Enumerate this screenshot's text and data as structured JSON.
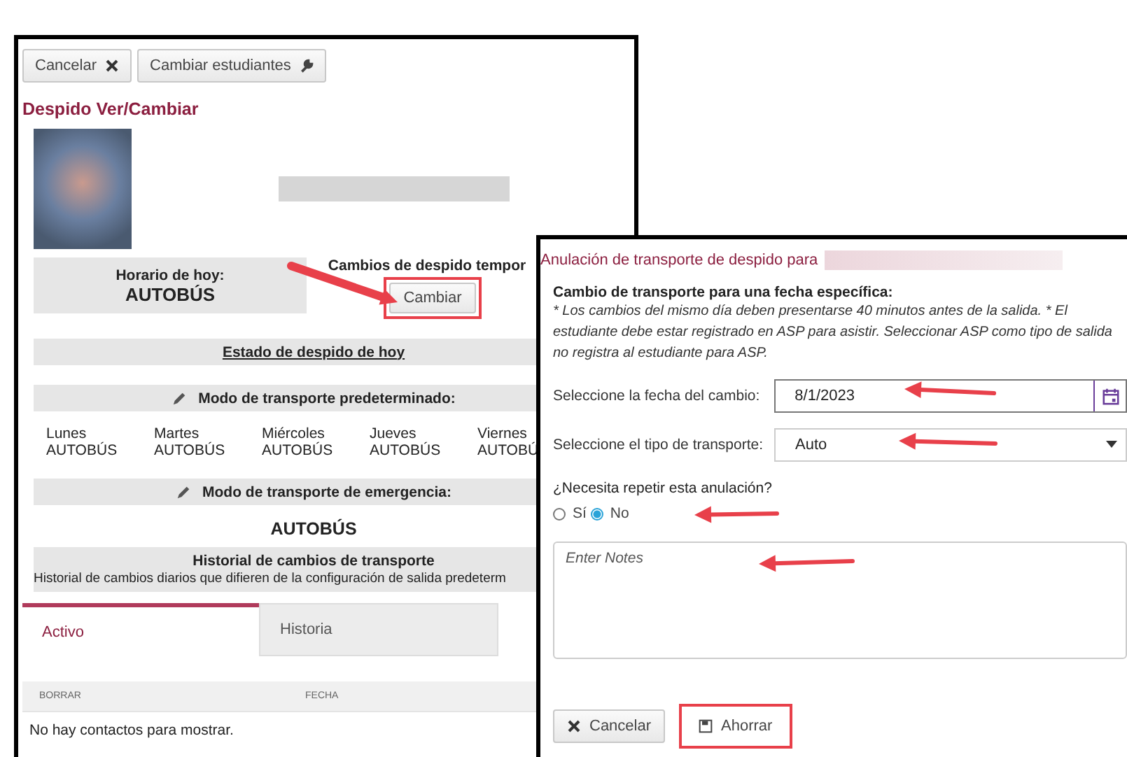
{
  "toolbar": {
    "buttons": [
      {
        "label": "Cancelar"
      },
      {
        "label": "Cambiar estudiantes"
      }
    ]
  },
  "page_title": "Despido Ver/Cambiar",
  "schedule": {
    "label": "Horario de hoy:",
    "value": "AUTOBÚS"
  },
  "temp_changes": {
    "label": "Cambios de despido tempor",
    "button": "Cambiar"
  },
  "status_link": "Estado de despido de hoy",
  "default_mode": {
    "heading": "Modo de transporte predeterminado:",
    "days": [
      {
        "day": "Lunes",
        "mode": "AUTOBÚS"
      },
      {
        "day": "Martes",
        "mode": "AUTOBÚS"
      },
      {
        "day": "Miércoles",
        "mode": "AUTOBÚS"
      },
      {
        "day": "Jueves",
        "mode": "AUTOBÚS"
      },
      {
        "day": "Viernes",
        "mode": "AUTOBÚ"
      }
    ]
  },
  "emergency_mode": {
    "heading": "Modo de transporte de emergencia:",
    "value": "AUTOBÚS"
  },
  "history": {
    "title": "Historial de cambios de transporte",
    "subtitle": "Historial de cambios diarios que difieren de la configuración de salida predeterm"
  },
  "tabs": [
    {
      "label": "Activo",
      "selected": true
    },
    {
      "label": "Historia",
      "selected": false
    }
  ],
  "table": {
    "columns": [
      "BORRAR",
      "FECHA"
    ],
    "empty": "No hay contactos para mostrar."
  },
  "dialog": {
    "title": "Anulación de transporte de despido para",
    "heading": "Cambio de transporte para una fecha específica:",
    "note": "* Los cambios del mismo día deben presentarse 40 minutos antes de la salida. * El estudiante debe estar registrado en ASP para asistir. Seleccionar ASP como tipo de salida no registra al estudiante para ASP.",
    "date": {
      "label": "Seleccione la fecha del cambio:",
      "value": "8/1/2023"
    },
    "transport": {
      "label": "Seleccione el tipo de transporte:",
      "value": "Auto"
    },
    "repeat": {
      "question": "¿Necesita repetir esta anulación?",
      "options": [
        {
          "label": "Sí",
          "selected": false
        },
        {
          "label": "No",
          "selected": true
        }
      ]
    },
    "notes": {
      "placeholder": "Enter Notes"
    },
    "buttons": [
      {
        "label": "Cancelar"
      },
      {
        "label": "Ahorrar"
      }
    ]
  }
}
